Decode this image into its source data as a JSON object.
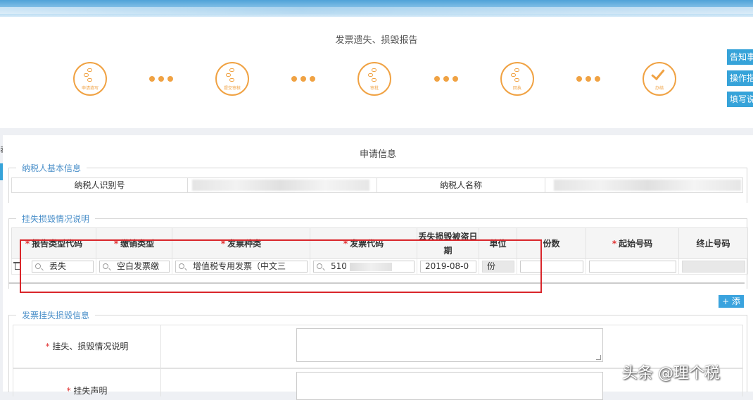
{
  "page_title": "发票遗失、损毁报告",
  "steps": [
    {
      "label": "申请填写",
      "icon": "flow-icon"
    },
    {
      "label": "提交审核",
      "icon": "flow-icon"
    },
    {
      "label": "审批",
      "icon": "flow-icon"
    },
    {
      "label": "回执",
      "icon": "flow-icon"
    },
    {
      "label": "办结",
      "icon": "check-icon"
    }
  ],
  "side_buttons": [
    "告知事",
    "操作指",
    "填写说"
  ],
  "left_mark": "表",
  "section_title": "申请信息",
  "taxpayer": {
    "legend": "纳税人基本信息",
    "id_label": "纳税人识别号",
    "name_label": "纳税人名称"
  },
  "loss": {
    "legend": "挂失损毁情况说明",
    "columns": [
      {
        "label": "报告类型代码",
        "required": true
      },
      {
        "label": "缴销类型",
        "required": true
      },
      {
        "label": "发票种类",
        "required": true
      },
      {
        "label": "发票代码",
        "required": true
      },
      {
        "label": "丢失损毁被盗日期",
        "required": false
      },
      {
        "label": "单位",
        "required": false
      },
      {
        "label": "份数",
        "required": false
      },
      {
        "label": "起始号码",
        "required": true
      },
      {
        "label": "终止号码",
        "required": false
      }
    ],
    "row": {
      "report_type": "丢失",
      "cancel_type": "空白发票缴",
      "invoice_kind": "增值税专用发票（中文三",
      "invoice_code": "510",
      "date": "2019-08-0",
      "unit": "份",
      "count": "",
      "start_no": "",
      "end_no": ""
    },
    "add_label": "+ 添"
  },
  "invoice_info": {
    "legend": "发票挂失损毁信息",
    "row1_label": "挂失、损毁情况说明",
    "row2_label": "挂失声明"
  },
  "watermark": "头条 @理个税",
  "colors": {
    "accent": "#f0a243",
    "blue": "#36a3d9",
    "highlight": "#d9262b"
  }
}
